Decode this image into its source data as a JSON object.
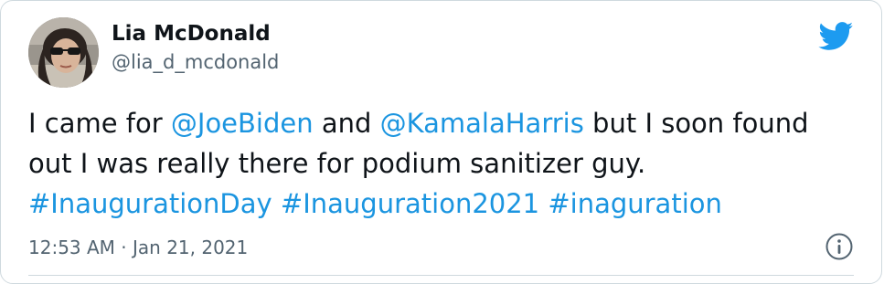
{
  "author": {
    "display_name": "Lia McDonald",
    "handle": "@lia_d_mcdonald"
  },
  "tweet": {
    "text_1": "I came for ",
    "mention_1": "@JoeBiden",
    "text_2": " and ",
    "mention_2": "@KamalaHarris",
    "text_3": " but I soon found out I was really there for podium sanitizer guy.",
    "hashtag_1": "#InaugurationDay",
    "hashtag_2": "#Inauguration2021",
    "hashtag_3": "#inaguration"
  },
  "meta": {
    "timestamp": "12:53 AM · Jan 21, 2021"
  },
  "icons": {
    "brand": "twitter-bird-icon",
    "info": "info-icon"
  },
  "colors": {
    "link": "#1b95e0",
    "text": "#0f1419",
    "muted": "#536471",
    "brand": "#1d9bf0",
    "border": "#cfd9de"
  }
}
